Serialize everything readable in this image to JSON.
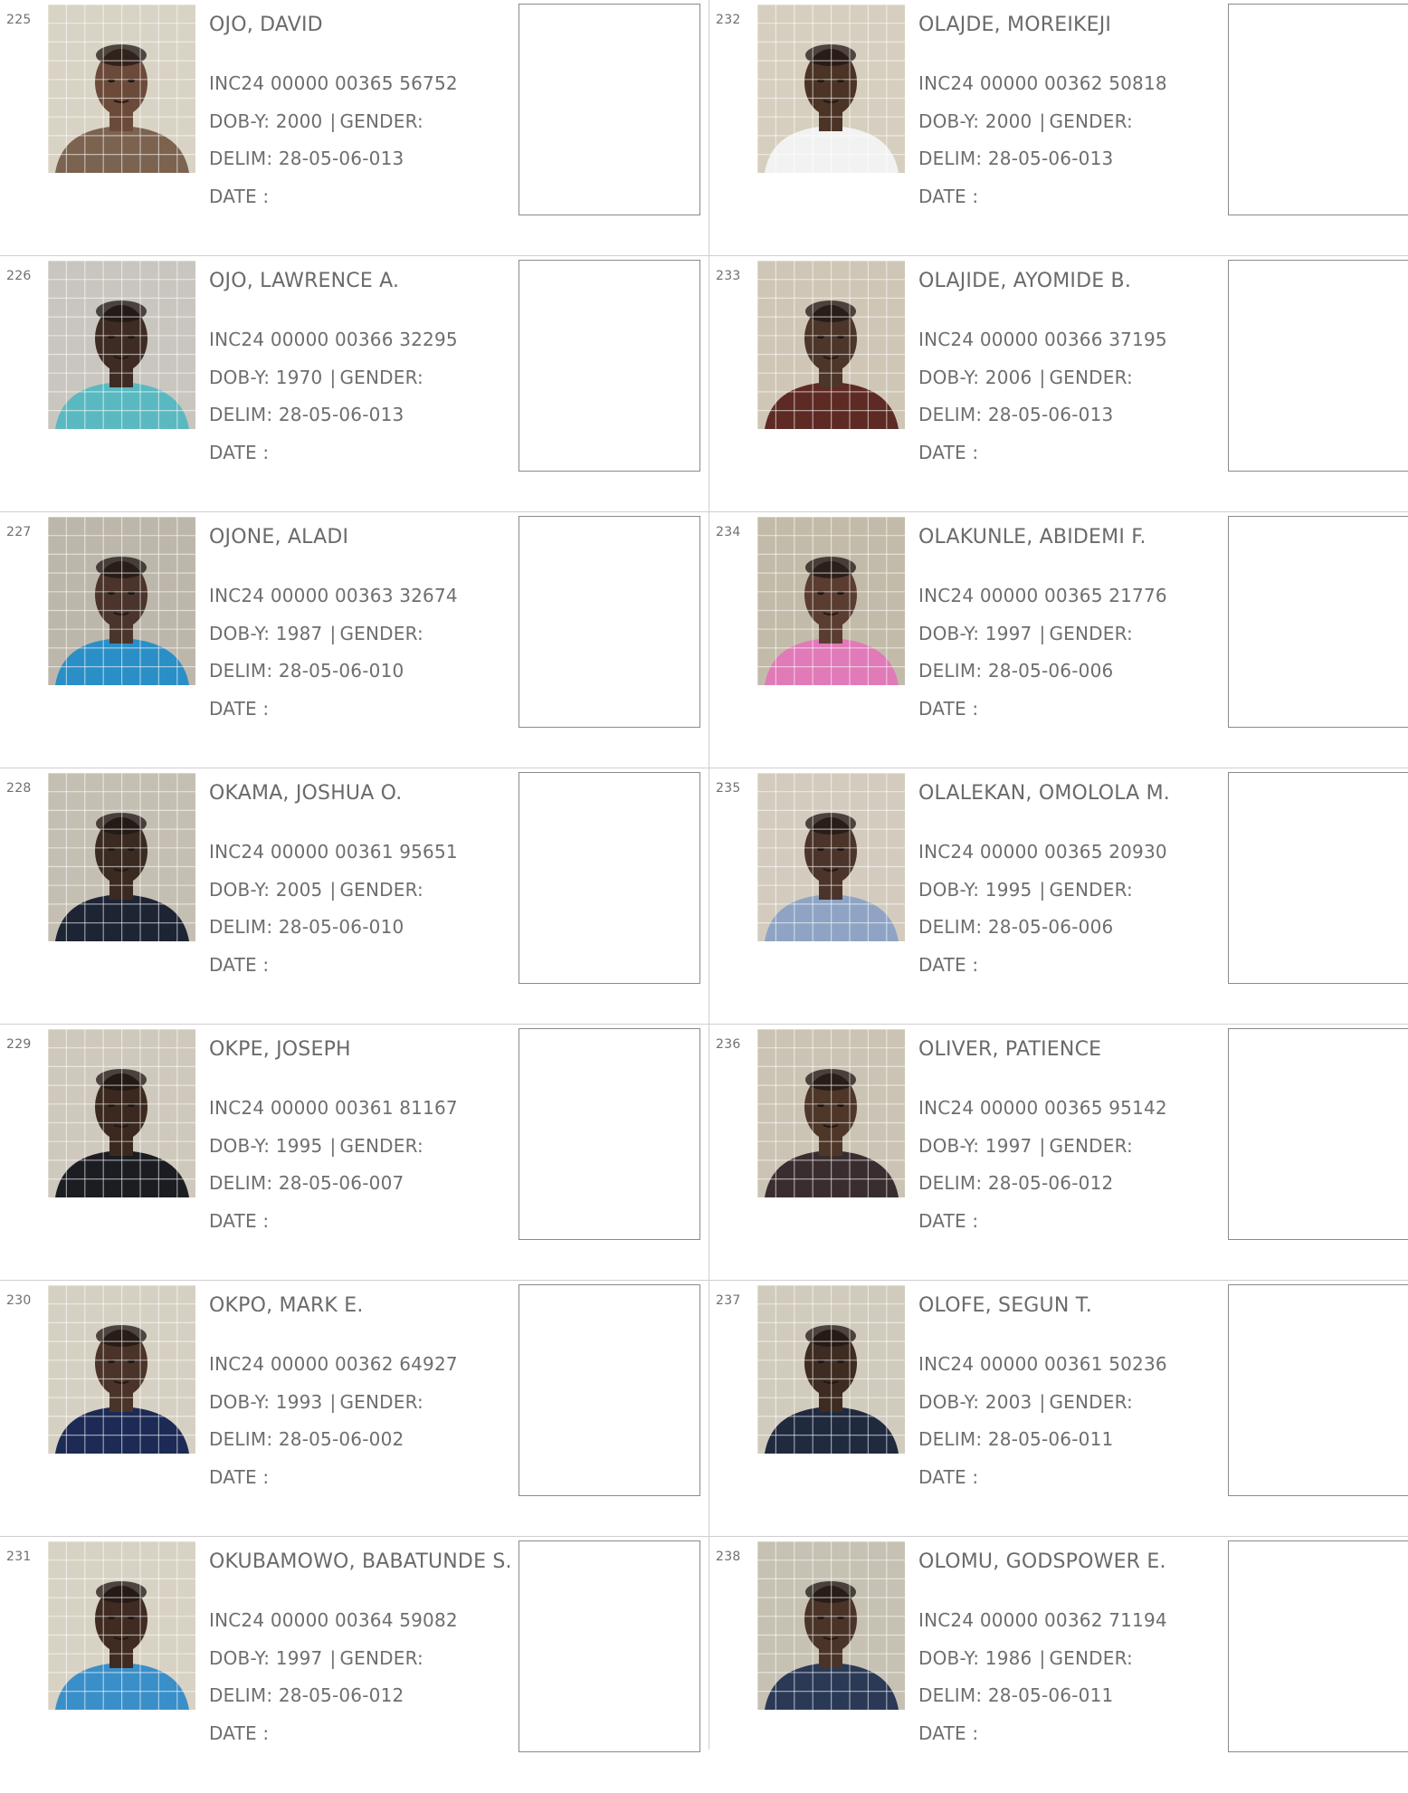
{
  "labels": {
    "dob": "DOB-Y:",
    "gender": "GENDER:",
    "gender_sep": "|",
    "delim": "DELIM:",
    "date": "DATE"
  },
  "records": [
    {
      "num": "225",
      "name": "OJO, DAVID",
      "inc": "INC24 00000 00365 56752",
      "dob": "2000",
      "delim": "28-05-06-013",
      "skin": "#6b4a39",
      "shirt": "#7b6350",
      "bg": "#d9d3c5"
    },
    {
      "num": "226",
      "name": "OJO, LAWRENCE A.",
      "inc": "INC24 00000 00366 32295",
      "dob": "1970",
      "delim": "28-05-06-013",
      "skin": "#3e2c24",
      "shirt": "#5ab9c0",
      "bg": "#c9c6bf"
    },
    {
      "num": "227",
      "name": "OJONE, ALADI",
      "inc": "INC24 00000 00363 32674",
      "dob": "1987",
      "delim": "28-05-06-010",
      "skin": "#4a342b",
      "shirt": "#2a8fc6",
      "bg": "#bdb7ab"
    },
    {
      "num": "228",
      "name": "OKAMA, JOSHUA O.",
      "inc": "INC24 00000 00361 95651",
      "dob": "2005",
      "delim": "28-05-06-010",
      "skin": "#3a2a22",
      "shirt": "#1d2434",
      "bg": "#c5bfb3"
    },
    {
      "num": "229",
      "name": "OKPE, JOSEPH",
      "inc": "INC24 00000 00361 81167",
      "dob": "1995",
      "delim": "28-05-06-007",
      "skin": "#3b291f",
      "shirt": "#1b1d22",
      "bg": "#cfc8bc"
    },
    {
      "num": "230",
      "name": "OKPO, MARK E.",
      "inc": "INC24 00000 00362 64927",
      "dob": "1993",
      "delim": "28-05-06-002",
      "skin": "#4a3328",
      "shirt": "#1c2a55",
      "bg": "#d6d0c3"
    },
    {
      "num": "231",
      "name": "OKUBAMOWO, BABATUNDE S.",
      "inc": "INC24 00000 00364 59082",
      "dob": "1997",
      "delim": "28-05-06-012",
      "skin": "#3f2b22",
      "shirt": "#3a8fc9",
      "bg": "#d8d2c4"
    },
    {
      "num": "232",
      "name": "OLAJDE, MOREIKEJI",
      "inc": "INC24 00000 00362 50818",
      "dob": "2000",
      "delim": "28-05-06-013",
      "skin": "#4b3326",
      "shirt": "#f2f2f2",
      "bg": "#d6cfbf"
    },
    {
      "num": "233",
      "name": "OLAJIDE, AYOMIDE B.",
      "inc": "INC24 00000 00366 37195",
      "dob": "2006",
      "delim": "28-05-06-013",
      "skin": "#4c3529",
      "shirt": "#5e2a24",
      "bg": "#cfc6b6"
    },
    {
      "num": "234",
      "name": "OLAKUNLE, ABIDEMI F.",
      "inc": "INC24 00000 00365 21776",
      "dob": "1997",
      "delim": "28-05-06-006",
      "skin": "#5a3d30",
      "shirt": "#e07ab8",
      "bg": "#c3bba9"
    },
    {
      "num": "235",
      "name": "OLALEKAN, OMOLOLA M.",
      "inc": "INC24 00000 00365 20930",
      "dob": "1995",
      "delim": "28-05-06-006",
      "skin": "#4b342a",
      "shirt": "#8fa4c4",
      "bg": "#d3ccbe"
    },
    {
      "num": "236",
      "name": "OLIVER, PATIENCE",
      "inc": "INC24 00000 00365 95142",
      "dob": "1997",
      "delim": "28-05-06-012",
      "skin": "#4e3629",
      "shirt": "#3a2d30",
      "bg": "#cbc4b4"
    },
    {
      "num": "237",
      "name": "OLOFE, SEGUN T.",
      "inc": "INC24 00000 00361 50236",
      "dob": "2003",
      "delim": "28-05-06-011",
      "skin": "#3e2b22",
      "shirt": "#1f2a3f",
      "bg": "#d1cbbd"
    },
    {
      "num": "238",
      "name": "OLOMU, GODSPOWER E.",
      "inc": "INC24 00000 00362 71194",
      "dob": "1986",
      "delim": "28-05-06-011",
      "skin": "#4a3428",
      "shirt": "#2a3956",
      "bg": "#c7c1b3"
    }
  ]
}
